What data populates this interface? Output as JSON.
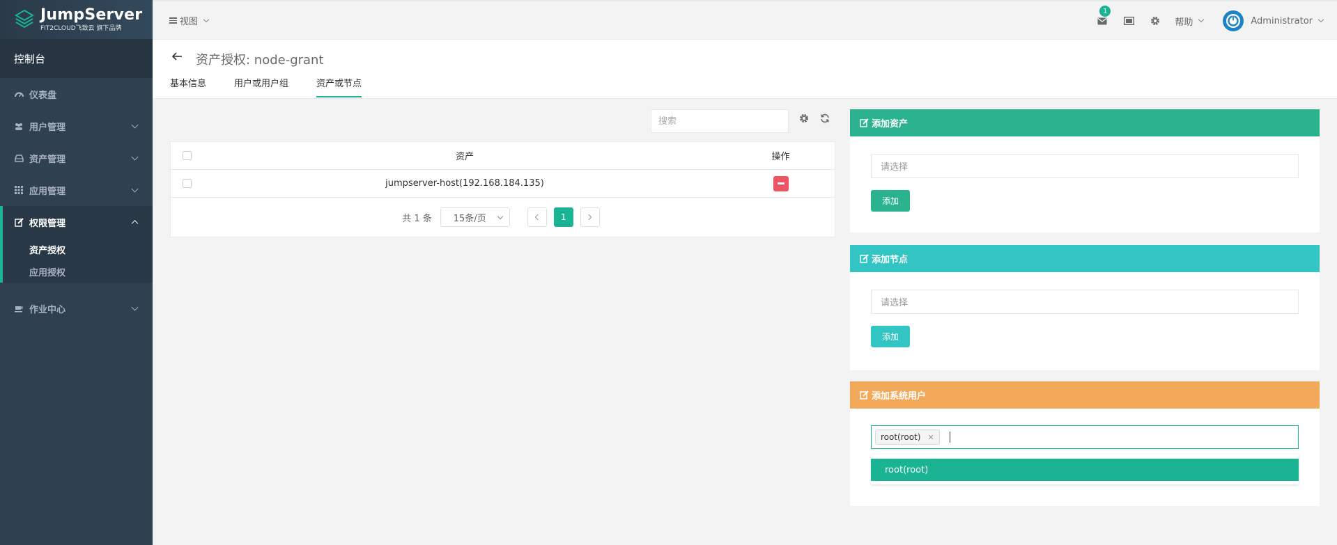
{
  "brand": {
    "name": "JumpServer",
    "subtitle": "FIT2CLOUD飞致云 旗下品牌"
  },
  "sidebar": {
    "console_label": "控制台",
    "items": [
      {
        "label": "仪表盘"
      },
      {
        "label": "用户管理"
      },
      {
        "label": "资产管理"
      },
      {
        "label": "应用管理"
      },
      {
        "label": "权限管理"
      },
      {
        "label": "作业中心"
      }
    ],
    "perm_sub": [
      {
        "label": "资产授权"
      },
      {
        "label": "应用授权"
      }
    ]
  },
  "topbar": {
    "view_label": "视图",
    "mail_badge": "1",
    "help_label": "帮助",
    "user_name": "Administrator"
  },
  "page": {
    "title": "资产授权: node-grant",
    "tabs": [
      {
        "label": "基本信息"
      },
      {
        "label": "用户或用户组"
      },
      {
        "label": "资产或节点"
      }
    ]
  },
  "search": {
    "placeholder": "搜索"
  },
  "table": {
    "headers": {
      "asset": "资产",
      "action": "操作"
    },
    "rows": [
      {
        "asset": "jumpserver-host(192.168.184.135)"
      }
    ],
    "pager": {
      "total": "共 1 条",
      "page_size": "15条/页",
      "current_page": "1"
    }
  },
  "panels": {
    "add_asset": {
      "title": "添加资产",
      "placeholder": "请选择",
      "button": "添加",
      "color": "#2bb390"
    },
    "add_node": {
      "title": "添加节点",
      "placeholder": "请选择",
      "button": "添加",
      "color": "#33c5c4"
    },
    "add_sysuser": {
      "title": "添加系统用户",
      "color": "#f3a95a",
      "selected_tag": "root(root)",
      "option": "root(root)"
    }
  },
  "colors": {
    "accent": "#1ab394",
    "danger": "#ed5565",
    "sidebar": "#2f4050"
  }
}
